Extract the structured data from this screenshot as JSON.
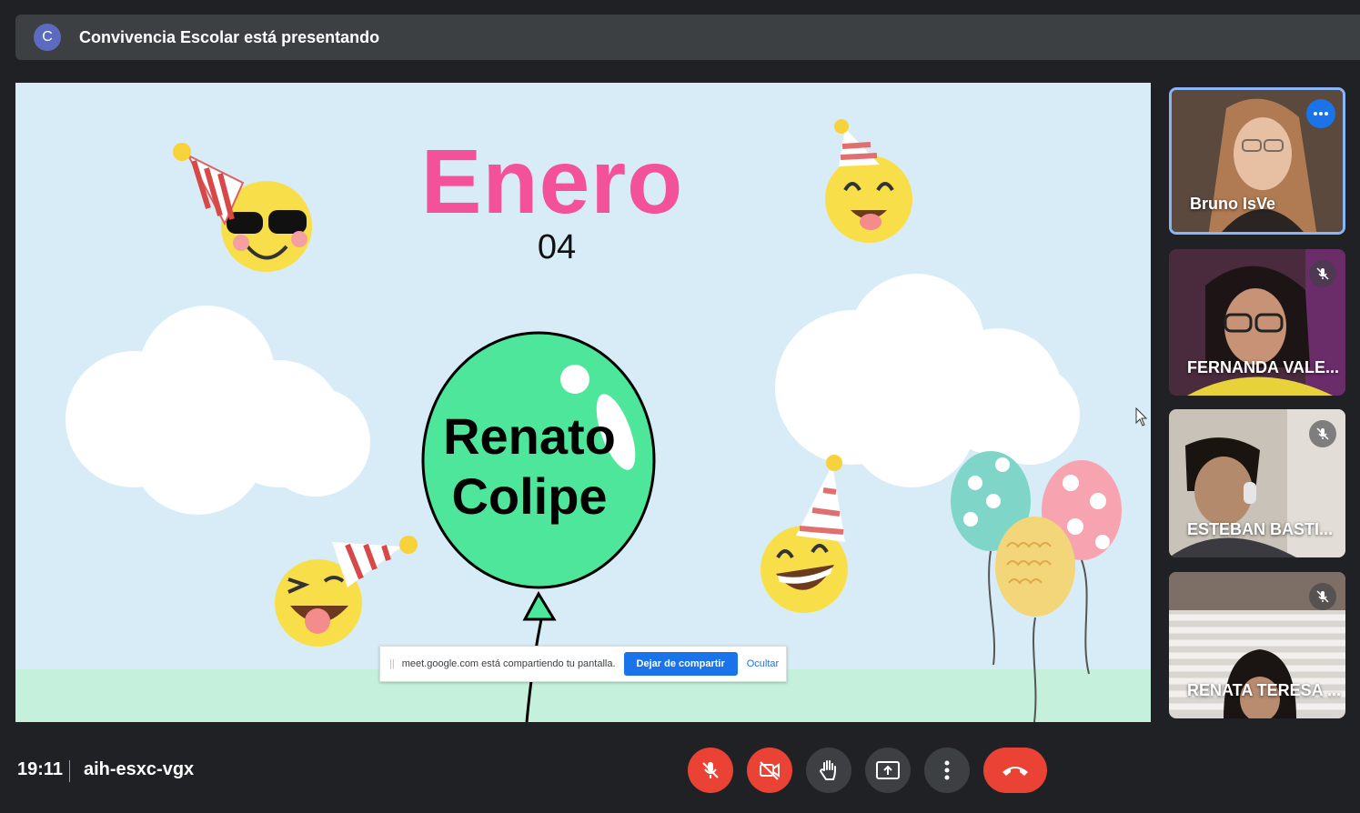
{
  "presenting": {
    "avatar_letter": "C",
    "text": "Convivencia Escolar está presentando"
  },
  "slide": {
    "month": "Enero",
    "day": "04",
    "name_line1": "Renato",
    "name_line2": "Colipe"
  },
  "share_notification": {
    "grip": "||",
    "text": "meet.google.com está compartiendo tu pantalla.",
    "stop_button": "Dejar de compartir",
    "hide_link": "Ocultar"
  },
  "participants": [
    {
      "name": "Bruno IsVe",
      "active": true
    },
    {
      "name": "FERNANDA VALE...",
      "muted": true
    },
    {
      "name": "ESTEBAN BASTI...",
      "muted": true
    },
    {
      "name": "RENATA TERESA ...",
      "muted": true
    }
  ],
  "meeting": {
    "time": "19:11",
    "code": "aih-esxc-vgx"
  },
  "colors": {
    "accent": "#1a73e8",
    "danger": "#ea4335",
    "month_pink": "#f4519b",
    "balloon_green": "#4de69a"
  },
  "icons": {
    "mic": "mic-off-icon",
    "camera": "camera-off-icon",
    "hand": "raise-hand-icon",
    "present": "present-screen-icon",
    "more": "more-options-icon",
    "end": "end-call-icon"
  }
}
